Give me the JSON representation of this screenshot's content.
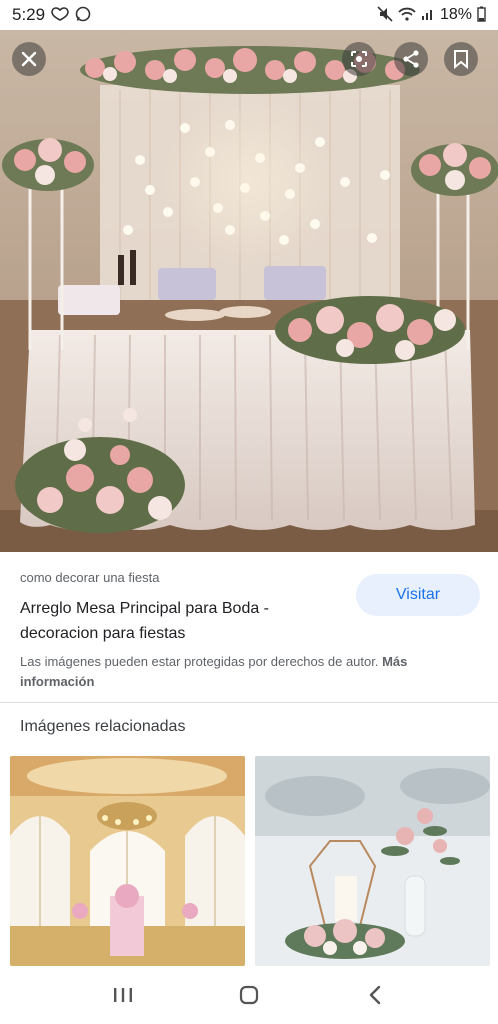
{
  "status_bar": {
    "time": "5:29",
    "battery": "18%",
    "icons": [
      "heart-msg-icon",
      "whatsapp-icon",
      "mute-icon",
      "wifi-icon",
      "signal-icon",
      "battery-icon"
    ]
  },
  "hero": {
    "alt": "wedding head table with flowers and curtain of lights",
    "actions": [
      "close-icon",
      "lens-icon",
      "share-icon",
      "bookmark-icon"
    ]
  },
  "result": {
    "source": "como decorar una fiesta",
    "title": "Arreglo Mesa Principal para Boda - decoracion para fiestas",
    "visit_label": "Visitar",
    "copyright": "Las imágenes pueden estar protegidas por derechos de autor.",
    "more_info": "Más información"
  },
  "related": {
    "heading": "Imágenes relacionadas",
    "items": [
      {
        "icon": "reception-hall-image"
      },
      {
        "icon": "table-centerpiece-image"
      }
    ]
  },
  "nav": {
    "icons": [
      "recent-apps-icon",
      "home-icon",
      "back-icon"
    ]
  },
  "colors": {
    "accent": "#1a73e8",
    "visit_bg": "#e8f0fe"
  }
}
